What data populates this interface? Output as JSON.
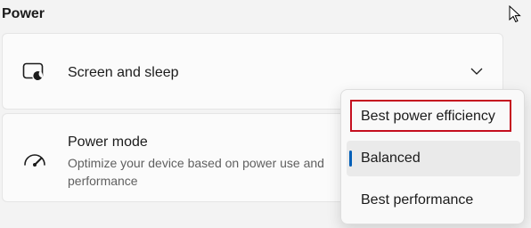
{
  "section": {
    "title": "Power"
  },
  "cards": {
    "screen_sleep": {
      "title": "Screen and sleep",
      "icon": "screen-sleep-icon",
      "expand_icon": "chevron-down-icon"
    },
    "power_mode": {
      "title": "Power mode",
      "description": "Optimize your device based on power use and performance",
      "icon": "speedometer-icon"
    }
  },
  "power_mode_menu": {
    "options": [
      "Best power efficiency",
      "Balanced",
      "Best performance"
    ],
    "selected": "Balanced",
    "highlighted": "Best power efficiency"
  },
  "colors": {
    "accent": "#005fb8",
    "highlight_border": "#c50f1f"
  }
}
